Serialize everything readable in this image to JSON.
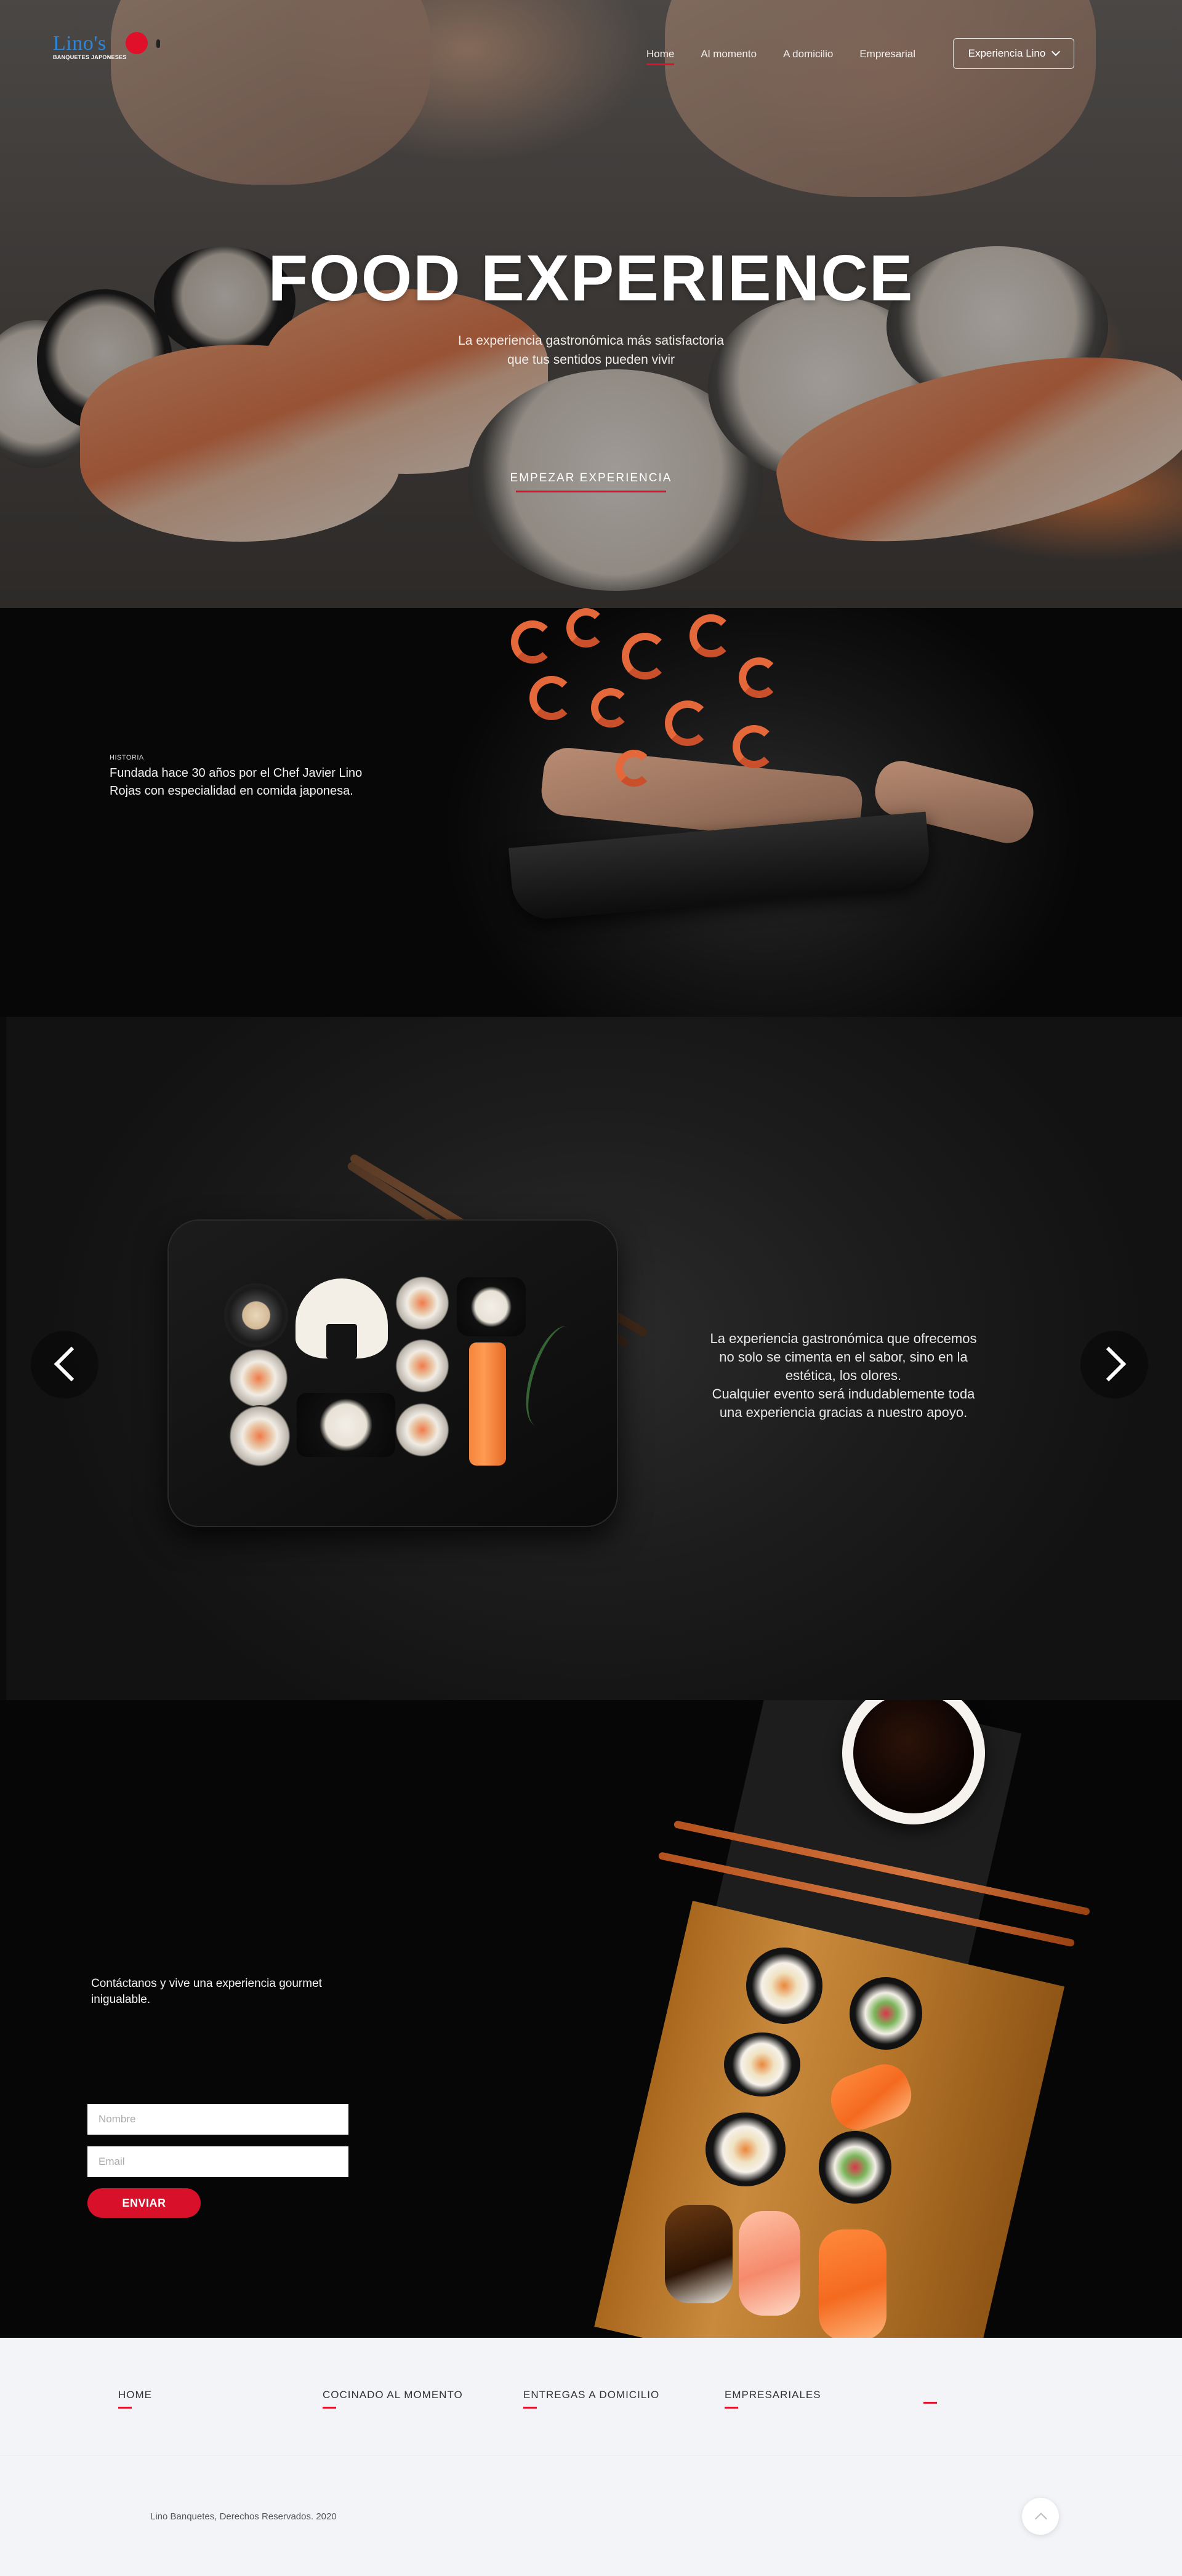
{
  "brand": {
    "name": "Lino's",
    "tagline": "BANQUETES JAPONESES",
    "accent_color": "#e0102a",
    "logo_color": "#2e86d6"
  },
  "nav": {
    "items": [
      {
        "label": "Home",
        "active": true
      },
      {
        "label": "Al momento",
        "active": false
      },
      {
        "label": "A domicilio",
        "active": false
      },
      {
        "label": "Empresarial",
        "active": false
      }
    ],
    "dropdown_label": "Experiencia Lino",
    "dropdown_icon": "chevron-down-icon"
  },
  "hero": {
    "title": "FOOD EXPERIENCE",
    "subtitle_line1": "La experiencia gastronómica más satisfactoria",
    "subtitle_line2": "que tus sentidos pueden vivir",
    "cta": "EMPEZAR EXPERIENCIA"
  },
  "historia": {
    "label": "HISTORIA",
    "text": "Fundada hace 30 años por el Chef Javier Lino Rojas con especialidad en comida japonesa."
  },
  "slider": {
    "text_line1": "La experiencia gastronómica que ofrecemos",
    "text_line2": "no solo se cimenta en el sabor, sino en la",
    "text_line3": "estética, los olores.",
    "text_line4": "Cualquier evento será indudablemente toda",
    "text_line5": "una experiencia gracias a nuestro apoyo.",
    "prev_icon": "chevron-left-icon",
    "next_icon": "chevron-right-icon"
  },
  "contacto": {
    "text": "Contáctanos y vive una experiencia gourmet inigualable.",
    "name_placeholder": "Nombre",
    "email_placeholder": "Email",
    "send_label": "ENVIAR"
  },
  "footer": {
    "links": [
      "HOME",
      "COCINADO AL MOMENTO",
      "ENTREGAS A DOMICILIO",
      "EMPRESARIALES"
    ],
    "copyright": "Lino Banquetes, Derechos Reservados. 2020",
    "to_top_icon": "chevron-up-icon"
  }
}
